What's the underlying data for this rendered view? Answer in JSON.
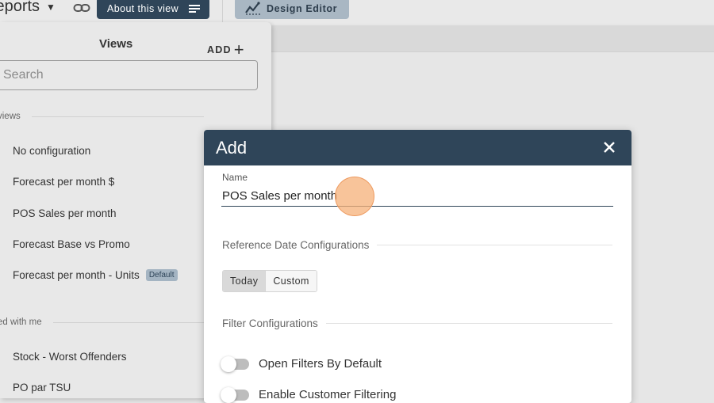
{
  "toolbar": {
    "reports_label": "Reports",
    "about_label": "About this view",
    "design_label": "Design Editor"
  },
  "views_panel": {
    "title": "Views",
    "add_label": "ADD",
    "search_placeholder": "Search",
    "section_my": "views",
    "section_shared": "ed with me",
    "my_items": [
      {
        "label": "No configuration"
      },
      {
        "label": "Forecast per month $"
      },
      {
        "label": "POS Sales per month"
      },
      {
        "label": "Forecast Base vs Promo"
      },
      {
        "label": "Forecast per month - Units",
        "badge": "Default"
      }
    ],
    "shared_items": [
      {
        "label": "Stock - Worst Offenders"
      },
      {
        "label": "PO par TSU"
      }
    ]
  },
  "modal": {
    "title": "Add",
    "name_label": "Name",
    "name_value": "POS Sales per month",
    "ref_date_section": "Reference Date Configurations",
    "ref_options": [
      "Today",
      "Custom"
    ],
    "selected_option": "Today",
    "filter_section": "Filter Configurations",
    "toggles": [
      {
        "label": "Open Filters By Default",
        "on": false
      },
      {
        "label": "Enable Customer Filtering",
        "on": false
      }
    ]
  },
  "colors": {
    "header": "#2f4559",
    "design_button": "#a9b7c3",
    "cursor_highlight": "#f6b078"
  }
}
